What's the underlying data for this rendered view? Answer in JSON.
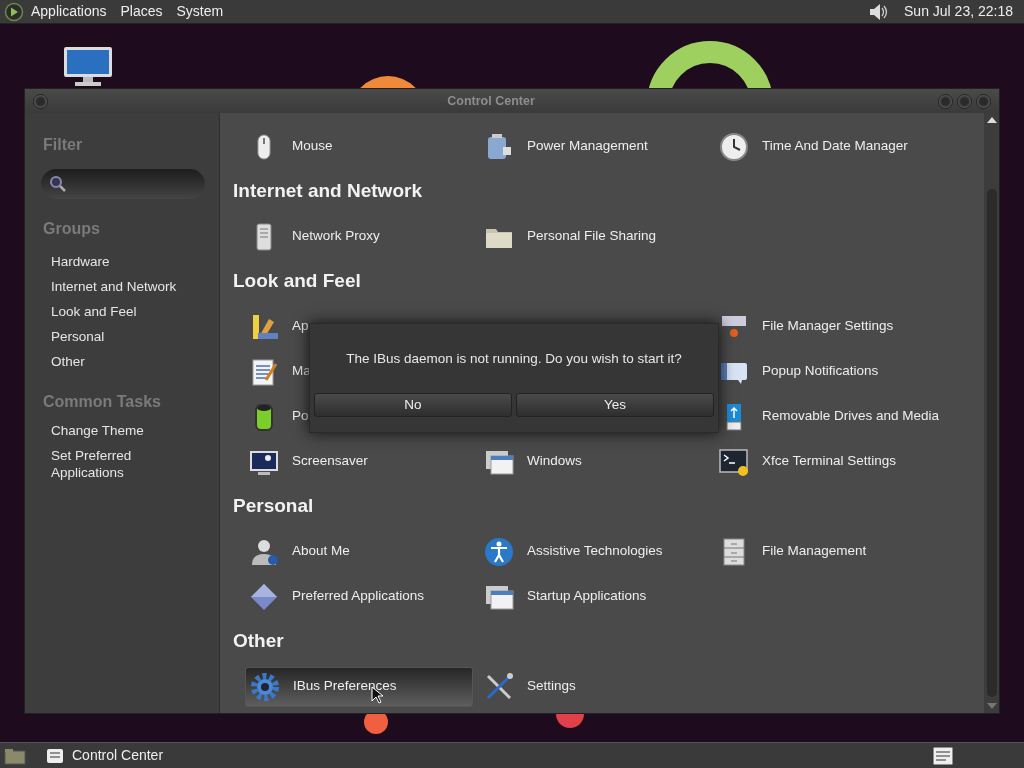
{
  "top_panel": {
    "menus": [
      "Applications",
      "Places",
      "System"
    ],
    "clock": "Sun Jul 23, 22:18"
  },
  "window": {
    "title": "Control Center"
  },
  "sidebar": {
    "filter_heading": "Filter",
    "groups_heading": "Groups",
    "groups": [
      "Hardware",
      "Internet and Network",
      "Look and Feel",
      "Personal",
      "Other"
    ],
    "tasks_heading": "Common Tasks",
    "tasks": [
      "Change Theme",
      "Set Preferred Applications"
    ]
  },
  "sections": [
    {
      "items": [
        {
          "kind": "item",
          "label": "Mouse",
          "selected": false
        },
        {
          "kind": "item",
          "label": "Power Management",
          "selected": false
        },
        {
          "kind": "item",
          "label": "Time And Date Manager",
          "selected": false
        }
      ]
    },
    {
      "title": "Internet and Network",
      "items": [
        {
          "kind": "item",
          "label": "Network Proxy",
          "selected": false
        },
        {
          "kind": "item",
          "label": "Personal File Sharing",
          "selected": false
        }
      ]
    },
    {
      "title": "Look and Feel",
      "items": [
        {
          "kind": "item",
          "label": "Ap",
          "selected": false
        },
        {
          "kind": "covered"
        },
        {
          "kind": "item",
          "label": "File Manager Settings",
          "selected": false
        },
        {
          "kind": "item",
          "label": "Ma",
          "selected": false
        },
        {
          "kind": "covered"
        },
        {
          "kind": "item",
          "label": "Popup Notifications",
          "selected": false
        },
        {
          "kind": "item",
          "label": "Po",
          "selected": false
        },
        {
          "kind": "covered"
        },
        {
          "kind": "item",
          "label": "Removable Drives and Media",
          "selected": false
        },
        {
          "kind": "item",
          "label": "Screensaver",
          "selected": false
        },
        {
          "kind": "item",
          "label": "Windows",
          "selected": false
        },
        {
          "kind": "item",
          "label": "Xfce Terminal Settings",
          "selected": false
        }
      ]
    },
    {
      "title": "Personal",
      "items": [
        {
          "kind": "item",
          "label": "About Me",
          "selected": false
        },
        {
          "kind": "item",
          "label": "Assistive Technologies",
          "selected": false
        },
        {
          "kind": "item",
          "label": "File Management",
          "selected": false
        },
        {
          "kind": "item",
          "label": "Preferred Applications",
          "selected": false
        },
        {
          "kind": "item",
          "label": "Startup Applications",
          "selected": false
        }
      ]
    },
    {
      "title": "Other",
      "items": [
        {
          "kind": "item",
          "label": "IBus Preferences",
          "selected": true
        },
        {
          "kind": "item",
          "label": "Settings",
          "selected": false
        }
      ]
    }
  ],
  "dialog": {
    "message": "The IBus daemon is not running. Do you wish to start it?",
    "buttons": [
      "No",
      "Yes"
    ]
  },
  "taskbar": {
    "tasks": [
      "Control Center"
    ]
  }
}
